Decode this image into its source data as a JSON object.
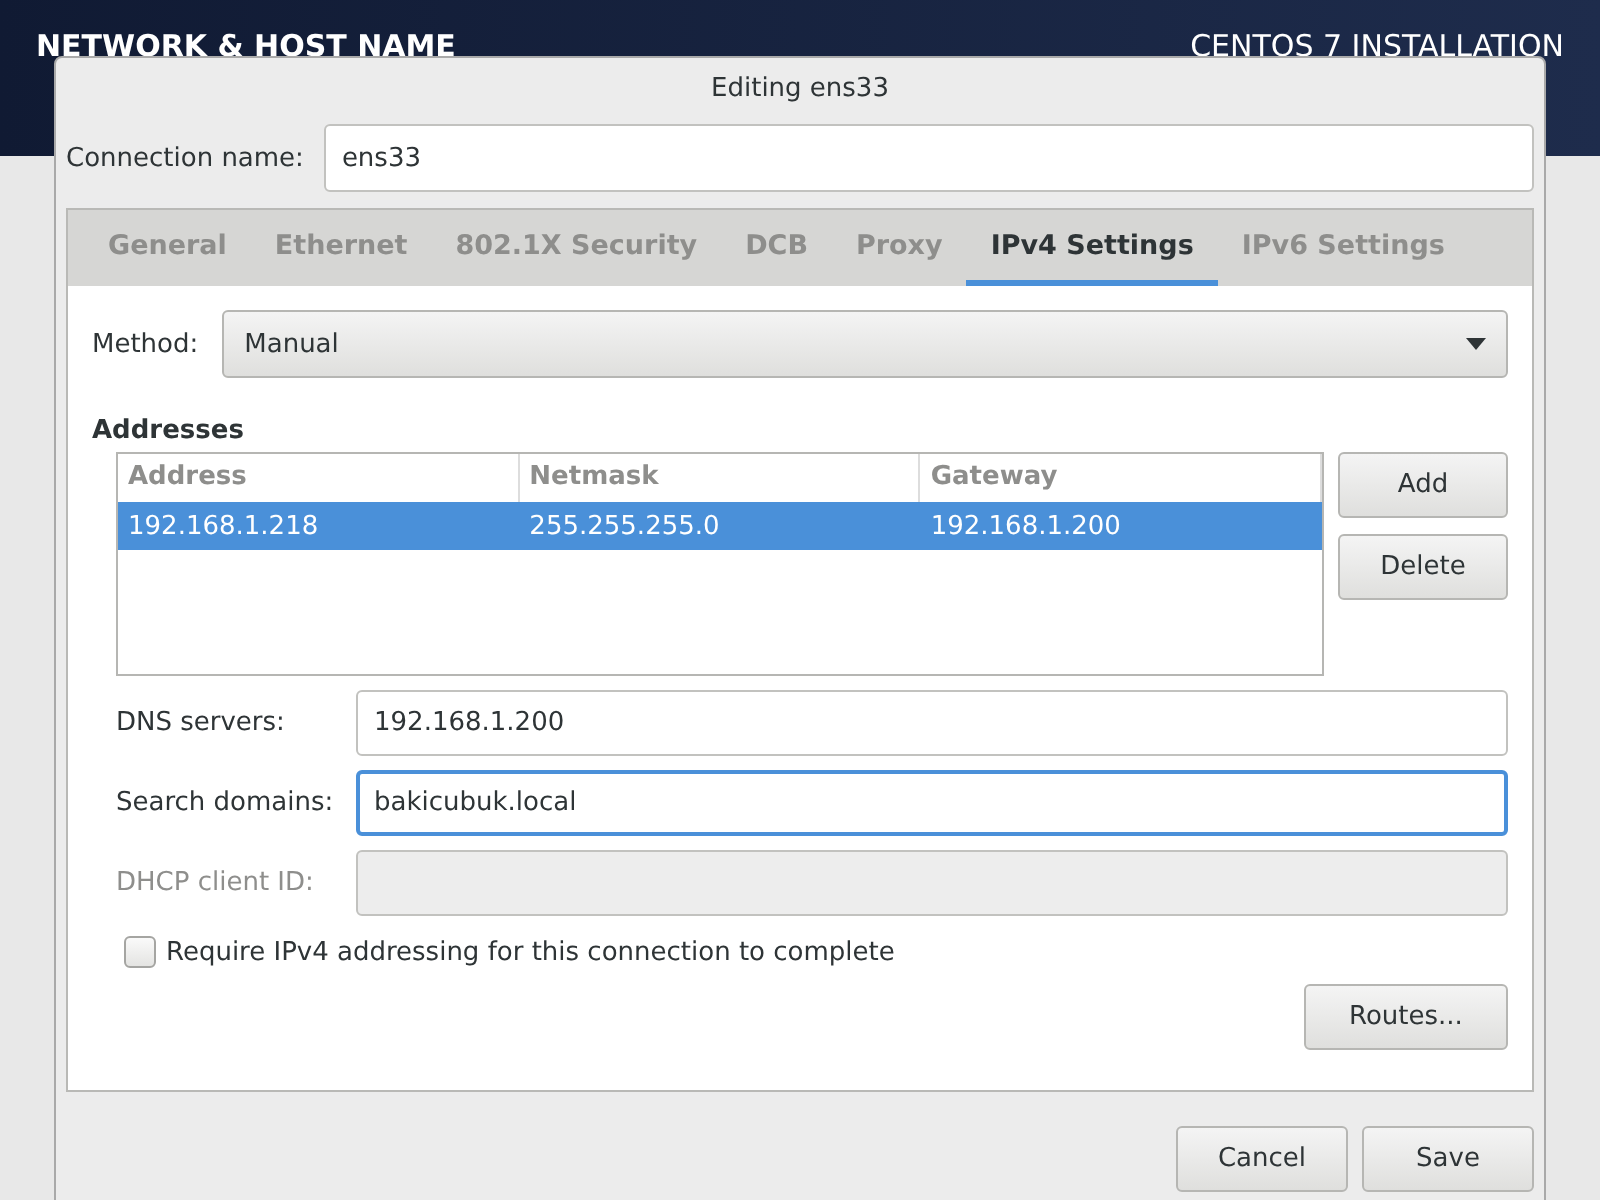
{
  "header": {
    "title": "NETWORK & HOST NAME",
    "product": "CENTOS 7 INSTALLATION"
  },
  "dialog": {
    "title": "Editing ens33",
    "connection_label": "Connection name:",
    "connection_name": "ens33"
  },
  "tabs": [
    {
      "label": "General",
      "selected": false
    },
    {
      "label": "Ethernet",
      "selected": false
    },
    {
      "label": "802.1X Security",
      "selected": false
    },
    {
      "label": "DCB",
      "selected": false
    },
    {
      "label": "Proxy",
      "selected": false
    },
    {
      "label": "IPv4 Settings",
      "selected": true
    },
    {
      "label": "IPv6 Settings",
      "selected": false
    }
  ],
  "method": {
    "label": "Method:",
    "value": "Manual"
  },
  "addresses": {
    "heading": "Addresses",
    "columns": [
      "Address",
      "Netmask",
      "Gateway"
    ],
    "rows": [
      {
        "cells": [
          "192.168.1.218",
          "255.255.255.0",
          "192.168.1.200"
        ],
        "selected": true
      }
    ],
    "buttons": [
      "Add",
      "Delete"
    ]
  },
  "fields": [
    {
      "label": "DNS servers:",
      "value": "192.168.1.200",
      "focused": false,
      "disabled": false
    },
    {
      "label": "Search domains:",
      "value": "bakicubuk.local",
      "focused": true,
      "disabled": false
    },
    {
      "label": "DHCP client ID:",
      "focused": false,
      "disabled": true
    }
  ],
  "require_ipv4": {
    "label": "Require IPv4 addressing for this connection to complete",
    "checked": false
  },
  "routes_button": "Routes...",
  "footer_buttons": [
    "Cancel",
    "Save"
  ]
}
